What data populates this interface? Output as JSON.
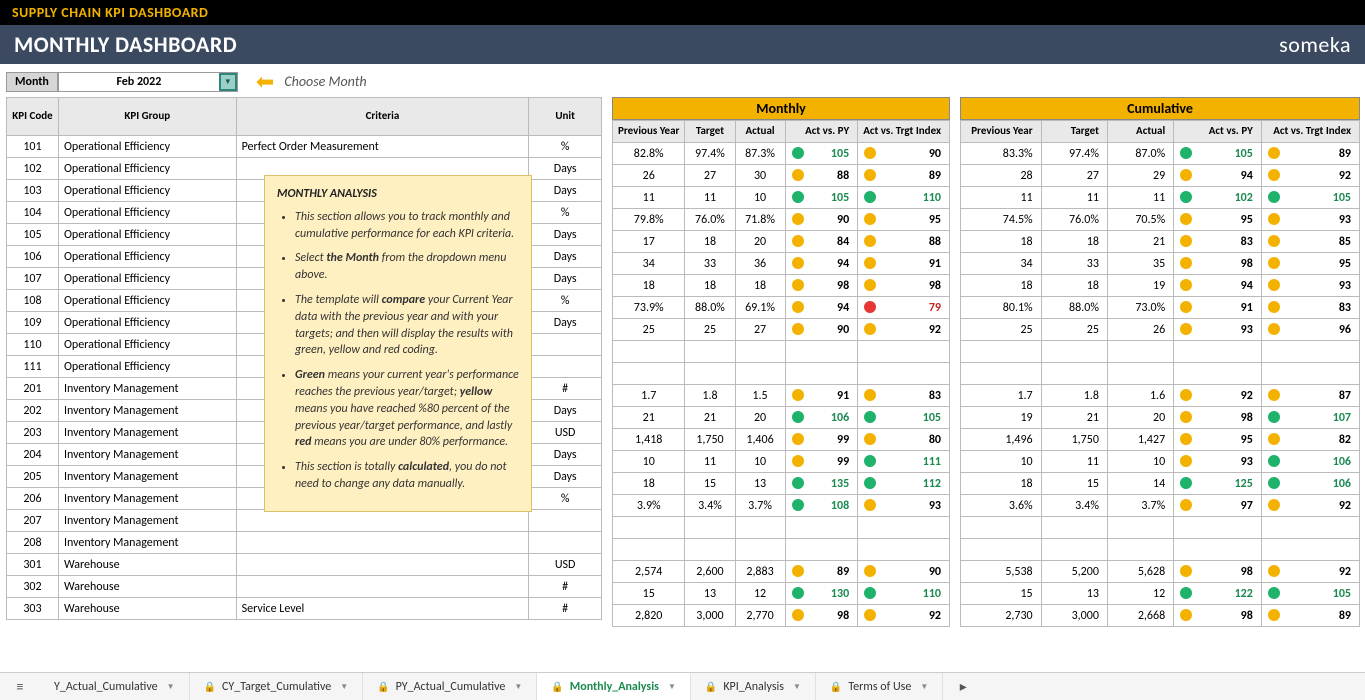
{
  "top_title": "SUPPLY CHAIN KPI DASHBOARD",
  "page_title": "MONTHLY DASHBOARD",
  "brand": "someka",
  "month_label": "Month",
  "month_value": "Feb 2022",
  "choose_text": "Choose Month",
  "left_headers": {
    "kpi_code": "KPI Code",
    "kpi_group": "KPI Group",
    "criteria": "Criteria",
    "unit": "Unit"
  },
  "section_monthly": "Monthly",
  "section_cumulative": "Cumulative",
  "metric_headers": {
    "py": "Previous Year",
    "target": "Target",
    "actual": "Actual",
    "avp": "Act vs. PY",
    "avt": "Act vs. Trgt Index"
  },
  "rows": [
    {
      "code": "101",
      "group": "Operational Efficiency",
      "criteria": "Perfect Order Measurement",
      "unit": "%",
      "m": {
        "py": "82.8%",
        "t": "97.4%",
        "a": "87.3%",
        "vp": [
          "g",
          "105"
        ],
        "vt": [
          "y",
          "90"
        ]
      },
      "c": {
        "py": "83.3%",
        "t": "97.4%",
        "a": "87.0%",
        "vp": [
          "g",
          "105"
        ],
        "vt": [
          "y",
          "89"
        ]
      }
    },
    {
      "code": "102",
      "group": "Operational Efficiency",
      "criteria": "",
      "unit": "Days",
      "m": {
        "py": "26",
        "t": "27",
        "a": "30",
        "vp": [
          "y",
          "88"
        ],
        "vt": [
          "y",
          "89"
        ]
      },
      "c": {
        "py": "28",
        "t": "27",
        "a": "29",
        "vp": [
          "y",
          "94"
        ],
        "vt": [
          "y",
          "92"
        ]
      }
    },
    {
      "code": "103",
      "group": "Operational Efficiency",
      "criteria": "",
      "unit": "Days",
      "m": {
        "py": "11",
        "t": "11",
        "a": "10",
        "vp": [
          "g",
          "105"
        ],
        "vt": [
          "g",
          "110"
        ]
      },
      "c": {
        "py": "11",
        "t": "11",
        "a": "11",
        "vp": [
          "g",
          "102"
        ],
        "vt": [
          "g",
          "105"
        ]
      }
    },
    {
      "code": "104",
      "group": "Operational Efficiency",
      "criteria": "",
      "unit": "%",
      "m": {
        "py": "79.8%",
        "t": "76.0%",
        "a": "71.8%",
        "vp": [
          "y",
          "90"
        ],
        "vt": [
          "y",
          "95"
        ]
      },
      "c": {
        "py": "74.5%",
        "t": "76.0%",
        "a": "70.5%",
        "vp": [
          "y",
          "95"
        ],
        "vt": [
          "y",
          "93"
        ]
      }
    },
    {
      "code": "105",
      "group": "Operational Efficiency",
      "criteria": "",
      "unit": "Days",
      "m": {
        "py": "17",
        "t": "18",
        "a": "20",
        "vp": [
          "y",
          "84"
        ],
        "vt": [
          "y",
          "88"
        ]
      },
      "c": {
        "py": "18",
        "t": "18",
        "a": "21",
        "vp": [
          "y",
          "83"
        ],
        "vt": [
          "y",
          "85"
        ]
      }
    },
    {
      "code": "106",
      "group": "Operational Efficiency",
      "criteria": "",
      "unit": "Days",
      "m": {
        "py": "34",
        "t": "33",
        "a": "36",
        "vp": [
          "y",
          "94"
        ],
        "vt": [
          "y",
          "91"
        ]
      },
      "c": {
        "py": "34",
        "t": "33",
        "a": "35",
        "vp": [
          "y",
          "98"
        ],
        "vt": [
          "y",
          "95"
        ]
      }
    },
    {
      "code": "107",
      "group": "Operational Efficiency",
      "criteria": "",
      "unit": "Days",
      "m": {
        "py": "18",
        "t": "18",
        "a": "18",
        "vp": [
          "y",
          "98"
        ],
        "vt": [
          "y",
          "98"
        ]
      },
      "c": {
        "py": "18",
        "t": "18",
        "a": "19",
        "vp": [
          "y",
          "94"
        ],
        "vt": [
          "y",
          "93"
        ]
      }
    },
    {
      "code": "108",
      "group": "Operational Efficiency",
      "criteria": "",
      "unit": "%",
      "m": {
        "py": "73.9%",
        "t": "88.0%",
        "a": "69.1%",
        "vp": [
          "y",
          "94"
        ],
        "vt": [
          "r",
          "79"
        ]
      },
      "c": {
        "py": "80.1%",
        "t": "88.0%",
        "a": "73.0%",
        "vp": [
          "y",
          "91"
        ],
        "vt": [
          "y",
          "83"
        ]
      }
    },
    {
      "code": "109",
      "group": "Operational Efficiency",
      "criteria": "",
      "unit": "Days",
      "m": {
        "py": "25",
        "t": "25",
        "a": "27",
        "vp": [
          "y",
          "90"
        ],
        "vt": [
          "y",
          "92"
        ]
      },
      "c": {
        "py": "25",
        "t": "25",
        "a": "26",
        "vp": [
          "y",
          "93"
        ],
        "vt": [
          "y",
          "96"
        ]
      }
    },
    {
      "code": "110",
      "group": "Operational Efficiency",
      "criteria": "",
      "unit": "",
      "m": {
        "py": "",
        "t": "",
        "a": "",
        "vp": [
          "",
          ""
        ],
        "vt": [
          "",
          ""
        ]
      },
      "c": {
        "py": "",
        "t": "",
        "a": "",
        "vp": [
          "",
          ""
        ],
        "vt": [
          "",
          ""
        ]
      }
    },
    {
      "code": "111",
      "group": "Operational Efficiency",
      "criteria": "",
      "unit": "",
      "m": {
        "py": "",
        "t": "",
        "a": "",
        "vp": [
          "",
          ""
        ],
        "vt": [
          "",
          ""
        ]
      },
      "c": {
        "py": "",
        "t": "",
        "a": "",
        "vp": [
          "",
          ""
        ],
        "vt": [
          "",
          ""
        ]
      }
    },
    {
      "code": "201",
      "group": "Inventory Management",
      "criteria": "",
      "unit": "#",
      "m": {
        "py": "1.7",
        "t": "1.8",
        "a": "1.5",
        "vp": [
          "y",
          "91"
        ],
        "vt": [
          "y",
          "83"
        ]
      },
      "c": {
        "py": "1.7",
        "t": "1.8",
        "a": "1.6",
        "vp": [
          "y",
          "92"
        ],
        "vt": [
          "y",
          "87"
        ]
      }
    },
    {
      "code": "202",
      "group": "Inventory Management",
      "criteria": "",
      "unit": "Days",
      "m": {
        "py": "21",
        "t": "21",
        "a": "20",
        "vp": [
          "g",
          "106"
        ],
        "vt": [
          "g",
          "105"
        ]
      },
      "c": {
        "py": "19",
        "t": "21",
        "a": "20",
        "vp": [
          "y",
          "98"
        ],
        "vt": [
          "g",
          "107"
        ]
      }
    },
    {
      "code": "203",
      "group": "Inventory Management",
      "criteria": "",
      "unit": "USD",
      "m": {
        "py": "1,418",
        "t": "1,750",
        "a": "1,406",
        "vp": [
          "y",
          "99"
        ],
        "vt": [
          "y",
          "80"
        ]
      },
      "c": {
        "py": "1,496",
        "t": "1,750",
        "a": "1,427",
        "vp": [
          "y",
          "95"
        ],
        "vt": [
          "y",
          "82"
        ]
      }
    },
    {
      "code": "204",
      "group": "Inventory Management",
      "criteria": "",
      "unit": "Days",
      "m": {
        "py": "10",
        "t": "11",
        "a": "10",
        "vp": [
          "y",
          "99"
        ],
        "vt": [
          "g",
          "111"
        ]
      },
      "c": {
        "py": "10",
        "t": "11",
        "a": "10",
        "vp": [
          "y",
          "93"
        ],
        "vt": [
          "g",
          "106"
        ]
      }
    },
    {
      "code": "205",
      "group": "Inventory Management",
      "criteria": "",
      "unit": "Days",
      "m": {
        "py": "18",
        "t": "15",
        "a": "13",
        "vp": [
          "g",
          "135"
        ],
        "vt": [
          "g",
          "112"
        ]
      },
      "c": {
        "py": "18",
        "t": "15",
        "a": "14",
        "vp": [
          "g",
          "125"
        ],
        "vt": [
          "g",
          "106"
        ]
      }
    },
    {
      "code": "206",
      "group": "Inventory Management",
      "criteria": "",
      "unit": "%",
      "m": {
        "py": "3.9%",
        "t": "3.4%",
        "a": "3.7%",
        "vp": [
          "g",
          "108"
        ],
        "vt": [
          "y",
          "93"
        ]
      },
      "c": {
        "py": "3.6%",
        "t": "3.4%",
        "a": "3.7%",
        "vp": [
          "y",
          "97"
        ],
        "vt": [
          "y",
          "92"
        ]
      }
    },
    {
      "code": "207",
      "group": "Inventory Management",
      "criteria": "",
      "unit": "",
      "m": {
        "py": "",
        "t": "",
        "a": "",
        "vp": [
          "",
          ""
        ],
        "vt": [
          "",
          ""
        ]
      },
      "c": {
        "py": "",
        "t": "",
        "a": "",
        "vp": [
          "",
          ""
        ],
        "vt": [
          "",
          ""
        ]
      }
    },
    {
      "code": "208",
      "group": "Inventory Management",
      "criteria": "",
      "unit": "",
      "m": {
        "py": "",
        "t": "",
        "a": "",
        "vp": [
          "",
          ""
        ],
        "vt": [
          "",
          ""
        ]
      },
      "c": {
        "py": "",
        "t": "",
        "a": "",
        "vp": [
          "",
          ""
        ],
        "vt": [
          "",
          ""
        ]
      }
    },
    {
      "code": "301",
      "group": "Warehouse",
      "criteria": "",
      "unit": "USD",
      "m": {
        "py": "2,574",
        "t": "2,600",
        "a": "2,883",
        "vp": [
          "y",
          "89"
        ],
        "vt": [
          "y",
          "90"
        ]
      },
      "c": {
        "py": "5,538",
        "t": "5,200",
        "a": "5,628",
        "vp": [
          "y",
          "98"
        ],
        "vt": [
          "y",
          "92"
        ]
      }
    },
    {
      "code": "302",
      "group": "Warehouse",
      "criteria": "",
      "unit": "#",
      "m": {
        "py": "15",
        "t": "13",
        "a": "12",
        "vp": [
          "g",
          "130"
        ],
        "vt": [
          "g",
          "110"
        ]
      },
      "c": {
        "py": "15",
        "t": "13",
        "a": "12",
        "vp": [
          "g",
          "122"
        ],
        "vt": [
          "g",
          "105"
        ]
      }
    },
    {
      "code": "303",
      "group": "Warehouse",
      "criteria": "Service Level",
      "unit": "#",
      "m": {
        "py": "2,820",
        "t": "3,000",
        "a": "2,770",
        "vp": [
          "y",
          "98"
        ],
        "vt": [
          "y",
          "92"
        ]
      },
      "c": {
        "py": "2,730",
        "t": "3,000",
        "a": "2,668",
        "vp": [
          "y",
          "98"
        ],
        "vt": [
          "y",
          "89"
        ]
      }
    }
  ],
  "tooltip": {
    "header": "MONTHLY ANALYSIS",
    "b1a": "This section allows you to track monthly and cumulative performance for each KPI criteria.",
    "b2a": "Select ",
    "b2b": "the Month",
    "b2c": " from the dropdown menu above.",
    "b3a": "The template will ",
    "b3b": "compare",
    "b3c": " your Current Year data with the previous year and with your targets; and then will display the results with green, yellow and red coding.",
    "b4g": "Green",
    "b4a": " means your current year's performance reaches the previous year/target; ",
    "b4y": "yellow",
    "b4b": " means you have reached %80 percent of the previous year/target performance, and lastly ",
    "b4r": "red",
    "b4c": " means you are under 80% performance.",
    "b5a": "This section is totally ",
    "b5b": "calculated",
    "b5c": ", you do not need to change any data manually."
  },
  "tabs": {
    "t1": "Y_Actual_Cumulative",
    "t2": "CY_Target_Cumulative",
    "t3": "PY_Actual_Cumulative",
    "t4": "Monthly_Analysis",
    "t5": "KPI_Analysis",
    "t6": "Terms of Use"
  }
}
